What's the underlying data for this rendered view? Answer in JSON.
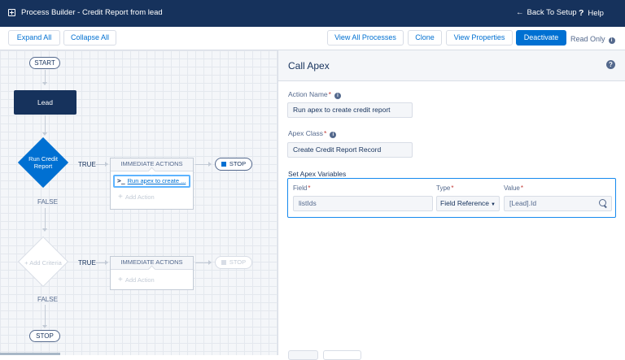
{
  "header": {
    "title": "Process Builder - Credit Report from lead",
    "back_label": "Back To Setup",
    "help_label": "Help"
  },
  "toolbar": {
    "expand_all": "Expand All",
    "collapse_all": "Collapse All",
    "view_all_processes": "View All Processes",
    "clone": "Clone",
    "view_properties": "View Properties",
    "deactivate": "Deactivate",
    "read_only": "Read Only"
  },
  "canvas": {
    "start_label": "START",
    "object_label": "Lead",
    "criteria_1": {
      "label": "Run Credit Report",
      "true_label": "TRUE",
      "false_label": "FALSE",
      "actions_header": "IMMEDIATE ACTIONS",
      "action_label": "Run apex to create ...",
      "add_action": "Add Action",
      "stop_label": "STOP"
    },
    "criteria_2": {
      "label": "Add Criteria",
      "true_label": "TRUE",
      "false_label": "FALSE",
      "actions_header": "IMMEDIATE ACTIONS",
      "add_action": "Add Action",
      "stop_label": "STOP"
    },
    "end_label": "STOP"
  },
  "panel": {
    "title": "Call Apex",
    "action_name_label": "Action Name",
    "action_name_value": "Run apex to create credit report",
    "apex_class_label": "Apex Class",
    "apex_class_value": "Create Credit Report Record",
    "set_vars_label": "Set Apex Variables",
    "columns": {
      "field": "Field",
      "type": "Type",
      "value": "Value"
    },
    "variable": {
      "field": "listIds",
      "type": "Field Reference",
      "value": "[Lead].Id"
    }
  },
  "colors": {
    "header_bg": "#16325c",
    "brand_blue": "#0070d2",
    "required_red": "#c23934"
  }
}
